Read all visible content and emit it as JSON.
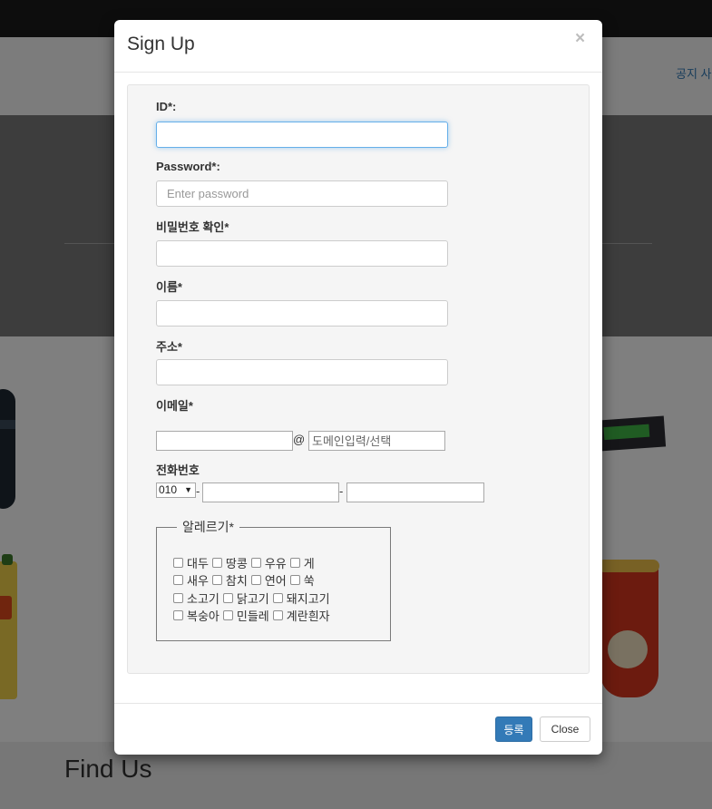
{
  "background": {
    "nav_link": "공지 사",
    "section_title": "Find Us"
  },
  "modal": {
    "title": "Sign Up",
    "close_icon": "×",
    "fields": {
      "id_label": "ID*:",
      "id_value": "",
      "password_label": "Password*:",
      "password_placeholder": "Enter password",
      "password_confirm_label": "비밀번호 확인*",
      "name_label": "이름*",
      "address_label": "주소*",
      "email_label": "이메일*",
      "email_at": "@",
      "email_domain_placeholder": "도메인입력/선택",
      "phone_label": "전화번호",
      "phone_prefix": "010",
      "phone_dash": "-"
    },
    "allergy": {
      "legend": "알레르기*",
      "rows": [
        [
          "대두",
          "땅콩",
          "우유",
          "게"
        ],
        [
          "새우",
          "참치",
          "연어",
          "쑥"
        ],
        [
          "소고기",
          "닭고기",
          "돼지고기"
        ],
        [
          "복숭아",
          "민들레",
          "계란흰자"
        ]
      ]
    },
    "buttons": {
      "submit": "등록",
      "close": "Close"
    }
  }
}
